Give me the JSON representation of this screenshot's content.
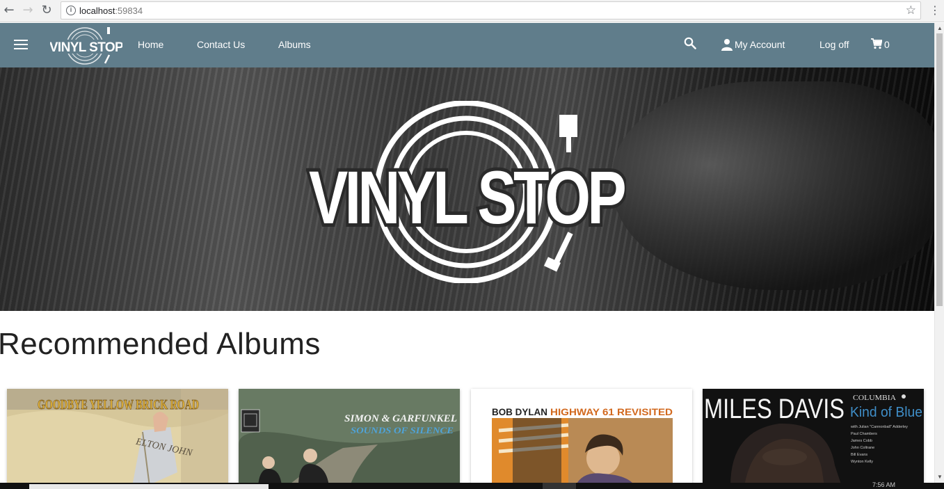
{
  "browser": {
    "url_host": "localhost",
    "url_port": ":59834"
  },
  "navbar": {
    "brand": "VINYL STOP",
    "links": [
      "Home",
      "Contact Us",
      "Albums"
    ],
    "account_label": "My Account",
    "logoff_label": "Log off",
    "cart_count": "0",
    "bar_color": "#607d8b"
  },
  "hero": {
    "logo_text": "VINYL STOP"
  },
  "main": {
    "section_title": "Recommended Albums",
    "albums": [
      {
        "artist": "ELTON JOHN",
        "title": "GOODBYE YELLOW BRICK ROAD"
      },
      {
        "artist": "SIMON & GARFUNKEL",
        "title": "SOUNDS OF SILENCE"
      },
      {
        "artist": "BOB DYLAN",
        "title": "HIGHWAY 61 REVISITED"
      },
      {
        "artist": "MILES DAVIS",
        "title": "Kind of Blue",
        "label": "COLUMBIA",
        "credits": [
          "with Julian \"Cannonball\" Adderley",
          "Paul Chambers",
          "James Cobb",
          "John Coltrane",
          "Bill Evans",
          "Wynton Kelly"
        ]
      }
    ]
  },
  "taskbar": {
    "clock": "7:56 AM"
  }
}
